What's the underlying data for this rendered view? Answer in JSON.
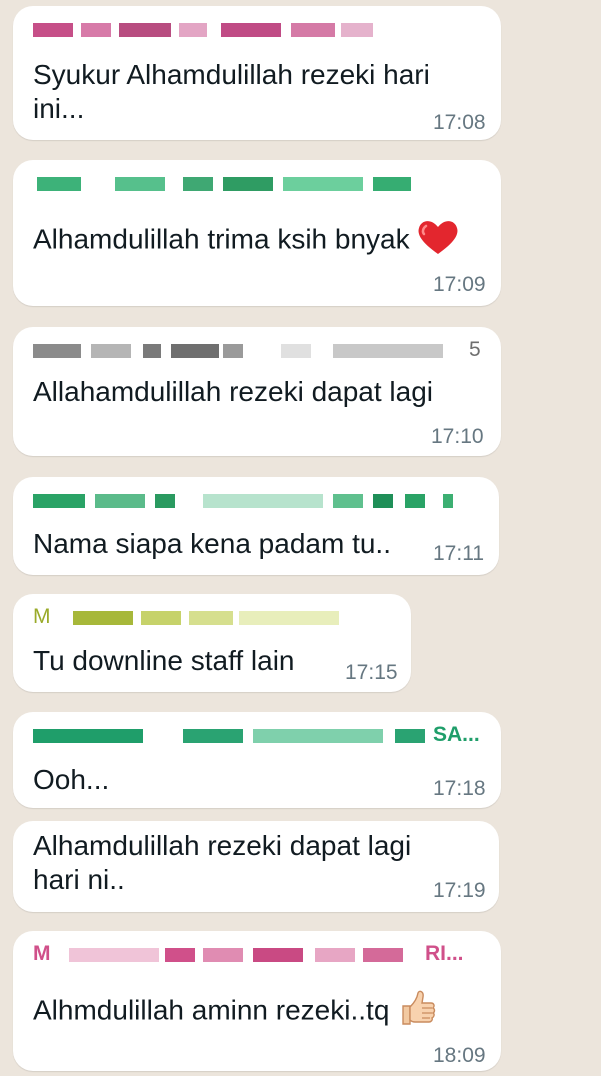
{
  "colors": {
    "background": "#ece5dc",
    "bubble": "#ffffff",
    "text": "#111b21",
    "time": "#667781",
    "sender_pink": "#c2407c",
    "sender_green": "#2aa366",
    "sender_gray": "#7a7a7a",
    "sender_olive": "#9aab2a",
    "sender_teal": "#1f9e6a",
    "sender_rose": "#d0508a"
  },
  "messages": [
    {
      "sender_text": "",
      "text_line1": "Syukur Alhamdulillah rezeki hari",
      "text_line2": "ini...",
      "time": "17:08"
    },
    {
      "sender_text": "",
      "text_line1": "Alhamdulillah trima ksih bnyak",
      "emoji": "red-heart-icon",
      "time": "17:09"
    },
    {
      "sender_text": "5",
      "text_line1": "Allahamdulillah rezeki dapat lagi",
      "time": "17:10"
    },
    {
      "sender_text": "",
      "text_line1": "Nama siapa kena padam tu..",
      "time": "17:11"
    },
    {
      "sender_text": "M",
      "text_line1": "Tu downline staff lain",
      "time": "17:15"
    },
    {
      "sender_text": "SA...",
      "text_line1": "Ooh...",
      "time": "17:18"
    },
    {
      "text_line1": "Alhamdulillah rezeki dapat lagi",
      "text_line2": "hari ni..",
      "time": "17:19"
    },
    {
      "sender_text": "RI...",
      "sender_prefix": "M",
      "text_line1": "Alhmdulillah aminn rezeki..tq",
      "emoji": "thumbs-up-icon",
      "time": "18:09"
    }
  ]
}
